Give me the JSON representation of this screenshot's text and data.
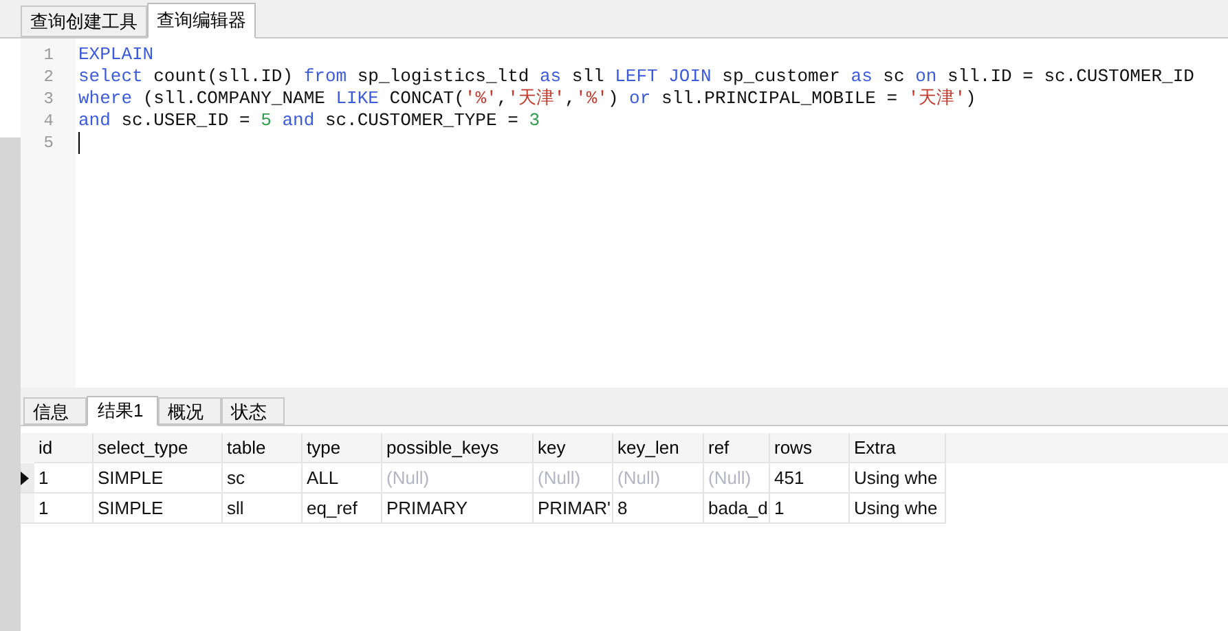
{
  "tabs": [
    {
      "label": "查询创建工具",
      "selected": false
    },
    {
      "label": "查询编辑器",
      "selected": true
    }
  ],
  "editor": {
    "lines": [
      {
        "number": "1",
        "tokens": [
          {
            "kind": "kw",
            "text": "EXPLAIN"
          }
        ]
      },
      {
        "number": "2",
        "tokens": [
          {
            "kind": "kw",
            "text": "select"
          },
          {
            "kind": "id",
            "text": " count(sll.ID) "
          },
          {
            "kind": "kw",
            "text": "from"
          },
          {
            "kind": "id",
            "text": " sp_logistics_ltd "
          },
          {
            "kind": "kw",
            "text": "as"
          },
          {
            "kind": "id",
            "text": " sll "
          },
          {
            "kind": "kw",
            "text": "LEFT JOIN"
          },
          {
            "kind": "id",
            "text": " sp_customer "
          },
          {
            "kind": "kw",
            "text": "as"
          },
          {
            "kind": "id",
            "text": " sc "
          },
          {
            "kind": "kw",
            "text": "on"
          },
          {
            "kind": "id",
            "text": " sll.ID = sc.CUSTOMER_ID"
          }
        ]
      },
      {
        "number": "3",
        "tokens": [
          {
            "kind": "kw",
            "text": "where"
          },
          {
            "kind": "id",
            "text": " (sll.COMPANY_NAME "
          },
          {
            "kind": "kw",
            "text": "LIKE"
          },
          {
            "kind": "id",
            "text": " CONCAT("
          },
          {
            "kind": "str",
            "text": "'%'"
          },
          {
            "kind": "id",
            "text": ","
          },
          {
            "kind": "str",
            "text": "'天津'"
          },
          {
            "kind": "id",
            "text": ","
          },
          {
            "kind": "str",
            "text": "'%'"
          },
          {
            "kind": "id",
            "text": ") "
          },
          {
            "kind": "kw",
            "text": "or"
          },
          {
            "kind": "id",
            "text": " sll.PRINCIPAL_MOBILE = "
          },
          {
            "kind": "str",
            "text": "'天津'"
          },
          {
            "kind": "id",
            "text": ")"
          }
        ]
      },
      {
        "number": "4",
        "tokens": [
          {
            "kind": "kw",
            "text": "and"
          },
          {
            "kind": "id",
            "text": " sc.USER_ID = "
          },
          {
            "kind": "num",
            "text": "5"
          },
          {
            "kind": "kw",
            "text": " and"
          },
          {
            "kind": "id",
            "text": " sc.CUSTOMER_TYPE = "
          },
          {
            "kind": "num",
            "text": "3"
          }
        ]
      },
      {
        "number": "5",
        "cursor": true
      }
    ]
  },
  "result_tabs": [
    {
      "label": "信息",
      "selected": false
    },
    {
      "label": "结果1",
      "selected": true
    },
    {
      "label": "概况",
      "selected": false
    },
    {
      "label": "状态",
      "selected": false
    }
  ],
  "table": {
    "columns": [
      "id",
      "select_type",
      "table",
      "type",
      "possible_keys",
      "key",
      "key_len",
      "ref",
      "rows",
      "Extra"
    ],
    "rows": [
      {
        "selected": true,
        "cells": [
          {
            "text": "1"
          },
          {
            "text": "SIMPLE"
          },
          {
            "text": "sc"
          },
          {
            "text": "ALL"
          },
          {
            "text": "(Null)",
            "kind": "null"
          },
          {
            "text": "(Null)",
            "kind": "null"
          },
          {
            "text": "(Null)",
            "kind": "null"
          },
          {
            "text": "(Null)",
            "kind": "null"
          },
          {
            "text": "451"
          },
          {
            "text": "Using whe"
          }
        ]
      },
      {
        "selected": false,
        "cells": [
          {
            "text": "1"
          },
          {
            "text": "SIMPLE"
          },
          {
            "text": "sll"
          },
          {
            "text": "eq_ref"
          },
          {
            "text": "PRIMARY"
          },
          {
            "text": "PRIMAR'"
          },
          {
            "text": "8"
          },
          {
            "text": "bada_d"
          },
          {
            "text": "1"
          },
          {
            "text": "Using whe"
          }
        ]
      }
    ]
  }
}
